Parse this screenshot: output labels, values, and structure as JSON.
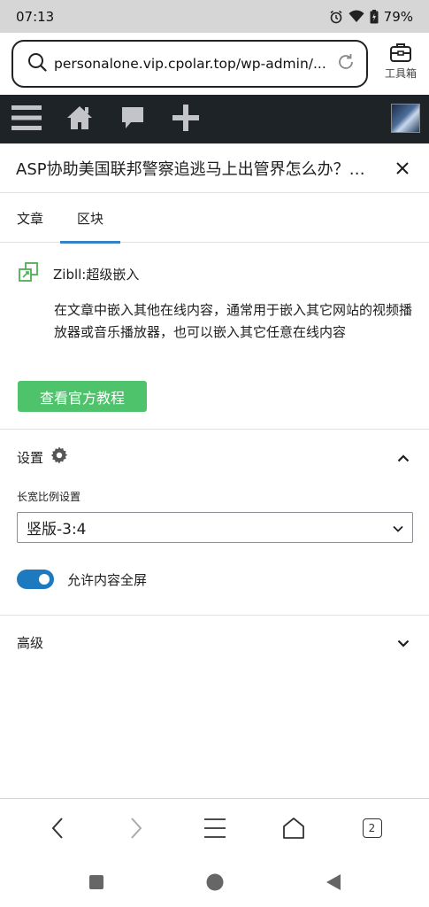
{
  "status_bar": {
    "time": "07:13",
    "battery": "79%"
  },
  "browser": {
    "url": "personalone.vip.cpolar.top/wp-admin/...",
    "toolbox_label": "工具箱",
    "tab_count": "2"
  },
  "editor": {
    "post_title": "ASP协助美国联邦警察追逃马上出管界怎么办？又…",
    "tabs": [
      {
        "label": "文章",
        "active": false
      },
      {
        "label": "区块",
        "active": true
      }
    ],
    "block": {
      "name": "Zibll:超级嵌入",
      "description": "在文章中嵌入其他在线内容，通常用于嵌入其它网站的视频播放器或音乐播放器，也可以嵌入其它任意在线内容",
      "tutorial_button": "查看官方教程"
    },
    "settings": {
      "title": "设置",
      "aspect_label": "长宽比例设置",
      "aspect_value": "竖版-3:4",
      "fullscreen_label": "允许内容全屏",
      "fullscreen_enabled": true
    },
    "advanced": {
      "title": "高级"
    }
  },
  "colors": {
    "admin_bar": "#1d2327",
    "accent": "#3582c4",
    "button_green": "#4fc36c",
    "toggle_on": "#1e7abf"
  }
}
